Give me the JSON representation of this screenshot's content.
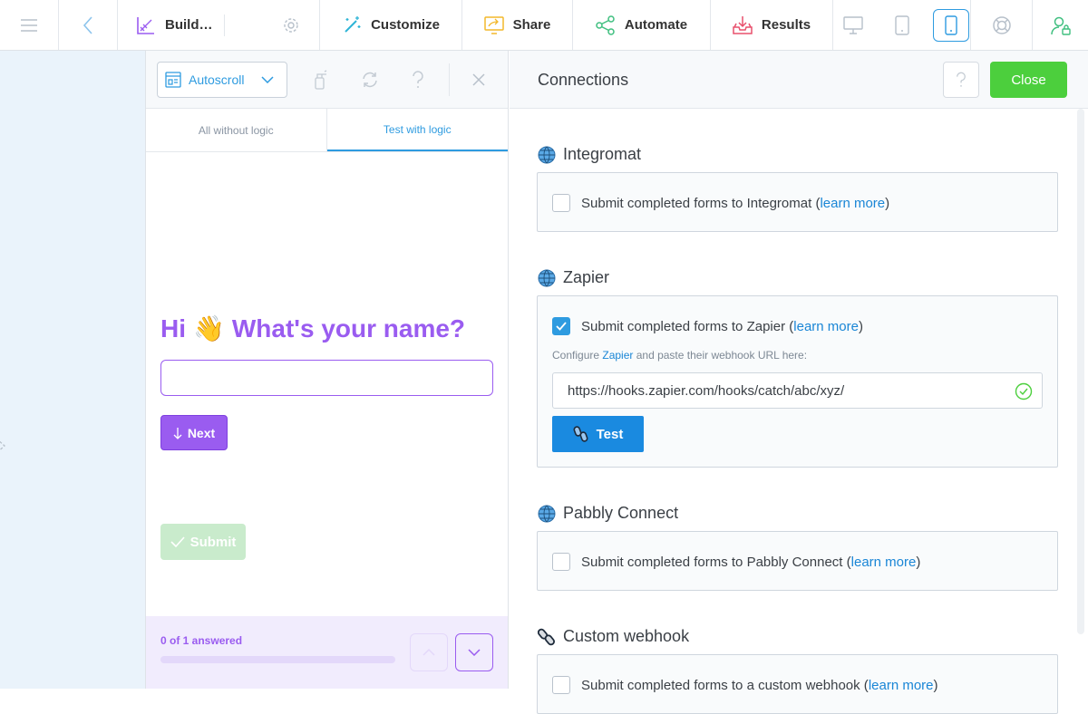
{
  "topbar": {
    "build_label": "Build…",
    "customize_label": "Customize",
    "share_label": "Share",
    "automate_label": "Automate",
    "results_label": "Results"
  },
  "preview": {
    "autoscroll_label": "Autoscroll",
    "tabs": [
      {
        "label": "All without logic"
      },
      {
        "label": "Test with logic"
      }
    ],
    "question_prefix": "Hi",
    "question_emoji": "👋",
    "question_text": "What's your name?",
    "answer_value": "",
    "next_label": "Next",
    "submit_label": "Submit",
    "answered_text": "0 of 1 answered",
    "progress_fraction": 0
  },
  "connections": {
    "title": "Connections",
    "close_label": "Close",
    "sections": [
      {
        "name": "Integromat",
        "text": "Submit completed forms to Integromat (",
        "link": "learn more",
        "suffix": ")",
        "checked": false
      },
      {
        "name": "Zapier",
        "text": "Submit completed forms to Zapier (",
        "link": "learn more",
        "suffix": ")",
        "checked": true,
        "hint_prefix": "Configure ",
        "hint_link": "Zapier",
        "hint_suffix": " and paste their webhook URL here:",
        "webhook_url": "https://hooks.zapier.com/hooks/catch/abc/xyz/",
        "test_label": "Test"
      },
      {
        "name": "Pabbly Connect",
        "text": "Submit completed forms to Pabbly Connect (",
        "link": "learn more",
        "suffix": ")",
        "checked": false
      },
      {
        "name": "Custom webhook",
        "text": "Submit completed forms to a custom webhook (",
        "link": "learn more",
        "suffix": ")",
        "checked": false
      }
    ]
  },
  "colors": {
    "accent_blue": "#2e9be0",
    "purple": "#9a5cf0",
    "green": "#4ccf3d"
  }
}
